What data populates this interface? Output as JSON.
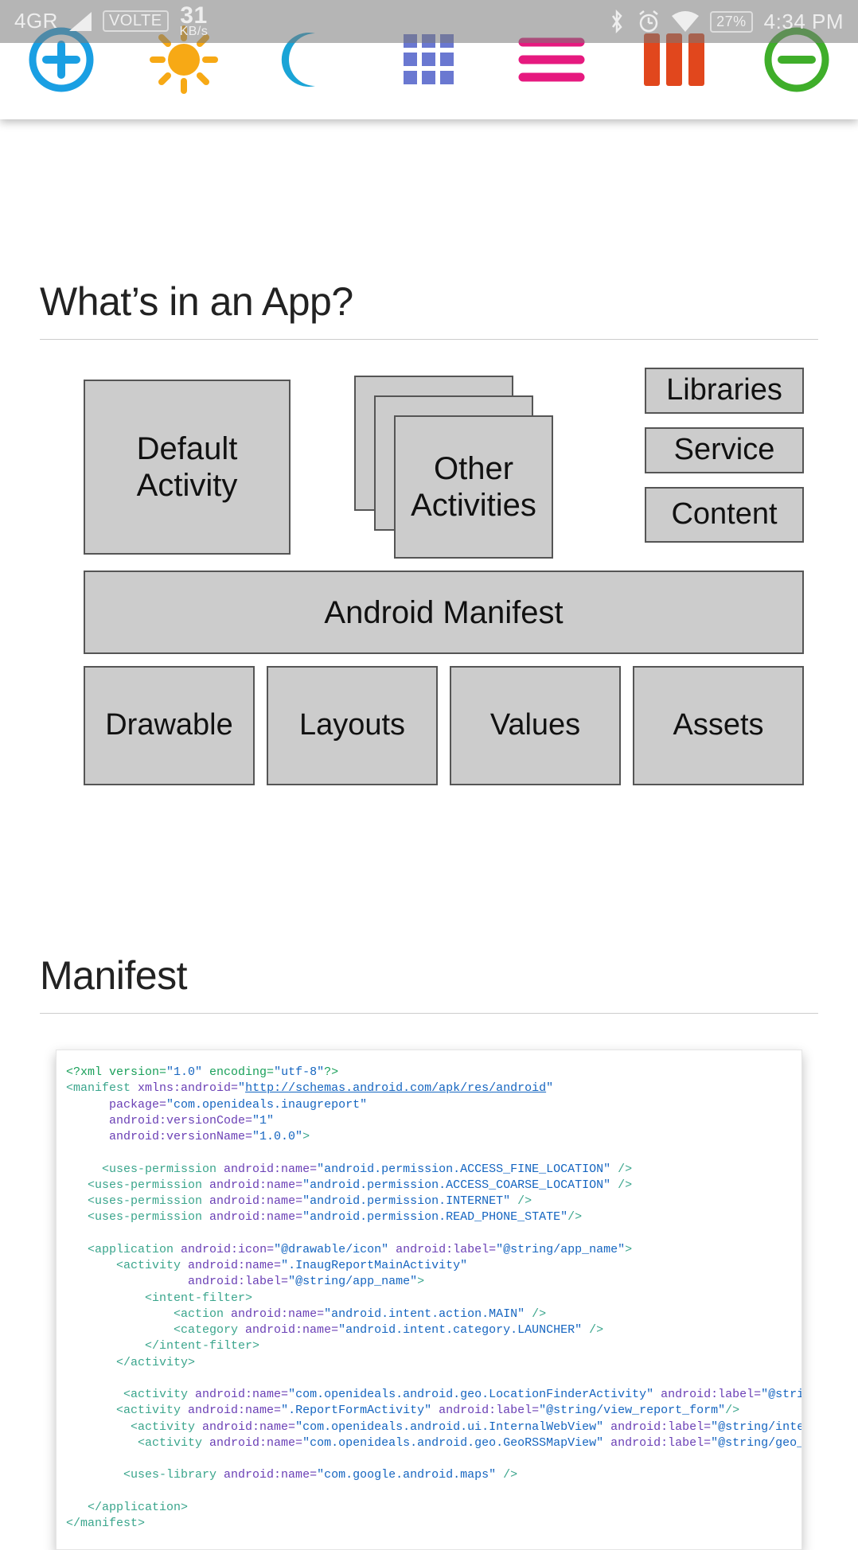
{
  "statusbar": {
    "net": "4GR",
    "volte": "VOLTE",
    "speed_val": "31",
    "speed_unit": "KB/s",
    "battery": "27%",
    "time": "4:34 PM"
  },
  "sections": {
    "app": "What’s in an App?",
    "manifest": "Manifest"
  },
  "diagram": {
    "default_activity": "Default\nActivity",
    "other_activities": "Other\nActivities",
    "libraries": "Libraries",
    "service": "Service",
    "content": "Content",
    "android_manifest": "Android Manifest",
    "drawable": "Drawable",
    "layouts": "Layouts",
    "values": "Values",
    "assets": "Assets"
  },
  "code": {
    "l01a": "<?xml version=",
    "l01b": "\"1.0\"",
    "l01c": " encoding=",
    "l01d": "\"utf-8\"",
    "l01e": "?>",
    "l02a": "<manifest ",
    "l02b": "xmlns:android=",
    "l02c": "\"",
    "l02u": "http://schemas.android.com/apk/res/android",
    "l02d": "\"",
    "l03a": "package=",
    "l03b": "\"com.openideals.inaugreport\"",
    "l04a": "android:versionCode=",
    "l04b": "\"1\"",
    "l05a": "android:versionName=",
    "l05b": "\"1.0.0\"",
    "l05c": ">",
    "l06a": "<uses-permission ",
    "l06b": "android:name=",
    "l06c": "\"android.permission.ACCESS_FINE_LOCATION\"",
    "l06d": " />",
    "l07a": "<uses-permission ",
    "l07b": "android:name=",
    "l07c": "\"android.permission.ACCESS_COARSE_LOCATION\"",
    "l07d": " />",
    "l08a": "<uses-permission ",
    "l08b": "android:name=",
    "l08c": "\"android.permission.INTERNET\"",
    "l08d": " />",
    "l09a": "<uses-permission ",
    "l09b": "android:name=",
    "l09c": "\"android.permission.READ_PHONE_STATE\"",
    "l09d": "/>",
    "l10a": "<application ",
    "l10b": "android:icon=",
    "l10c": "\"@drawable/icon\"",
    "l10d": " android:label=",
    "l10e": "\"@string/app_name\"",
    "l10f": ">",
    "l11a": "<activity ",
    "l11b": "android:name=",
    "l11c": "\".InaugReportMainActivity\"",
    "l12a": "android:label=",
    "l12b": "\"@string/app_name\"",
    "l12c": ">",
    "l13a": "<intent-filter>",
    "l14a": "<action ",
    "l14b": "android:name=",
    "l14c": "\"android.intent.action.MAIN\"",
    "l14d": " />",
    "l15a": "<category ",
    "l15b": "android:name=",
    "l15c": "\"android.intent.category.LAUNCHER\"",
    "l15d": " />",
    "l16a": "</intent-filter>",
    "l17a": "</activity>",
    "l18a": "<activity ",
    "l18b": "android:name=",
    "l18c": "\"com.openideals.android.geo.LocationFinderActivity\"",
    "l18d": " android:label=",
    "l18e": "\"@string/view_location_finder\"",
    "l18f": "/>",
    "l19a": "<activity ",
    "l19b": "android:name=",
    "l19c": "\".ReportFormActivity\"",
    "l19d": " android:label=",
    "l19e": "\"@string/view_report_form\"",
    "l19f": "/>",
    "l20a": "<activity ",
    "l20b": "android:name=",
    "l20c": "\"com.openideals.android.ui.InternalWebView\"",
    "l20d": " android:label=",
    "l20e": "\"@string/internal_web_view\"",
    "l20f": " />",
    "l21a": "<activity ",
    "l21b": "android:name=",
    "l21c": "\"com.openideals.android.geo.GeoRSSMapView\"",
    "l21d": " android:label=",
    "l21e": "\"@string/geo_map_view\"",
    "l21f": " />",
    "l22a": "<uses-library ",
    "l22b": "android:name=",
    "l22c": "\"com.google.android.maps\"",
    "l22d": " />",
    "l23a": "</application>",
    "l24a": "</manifest>"
  }
}
